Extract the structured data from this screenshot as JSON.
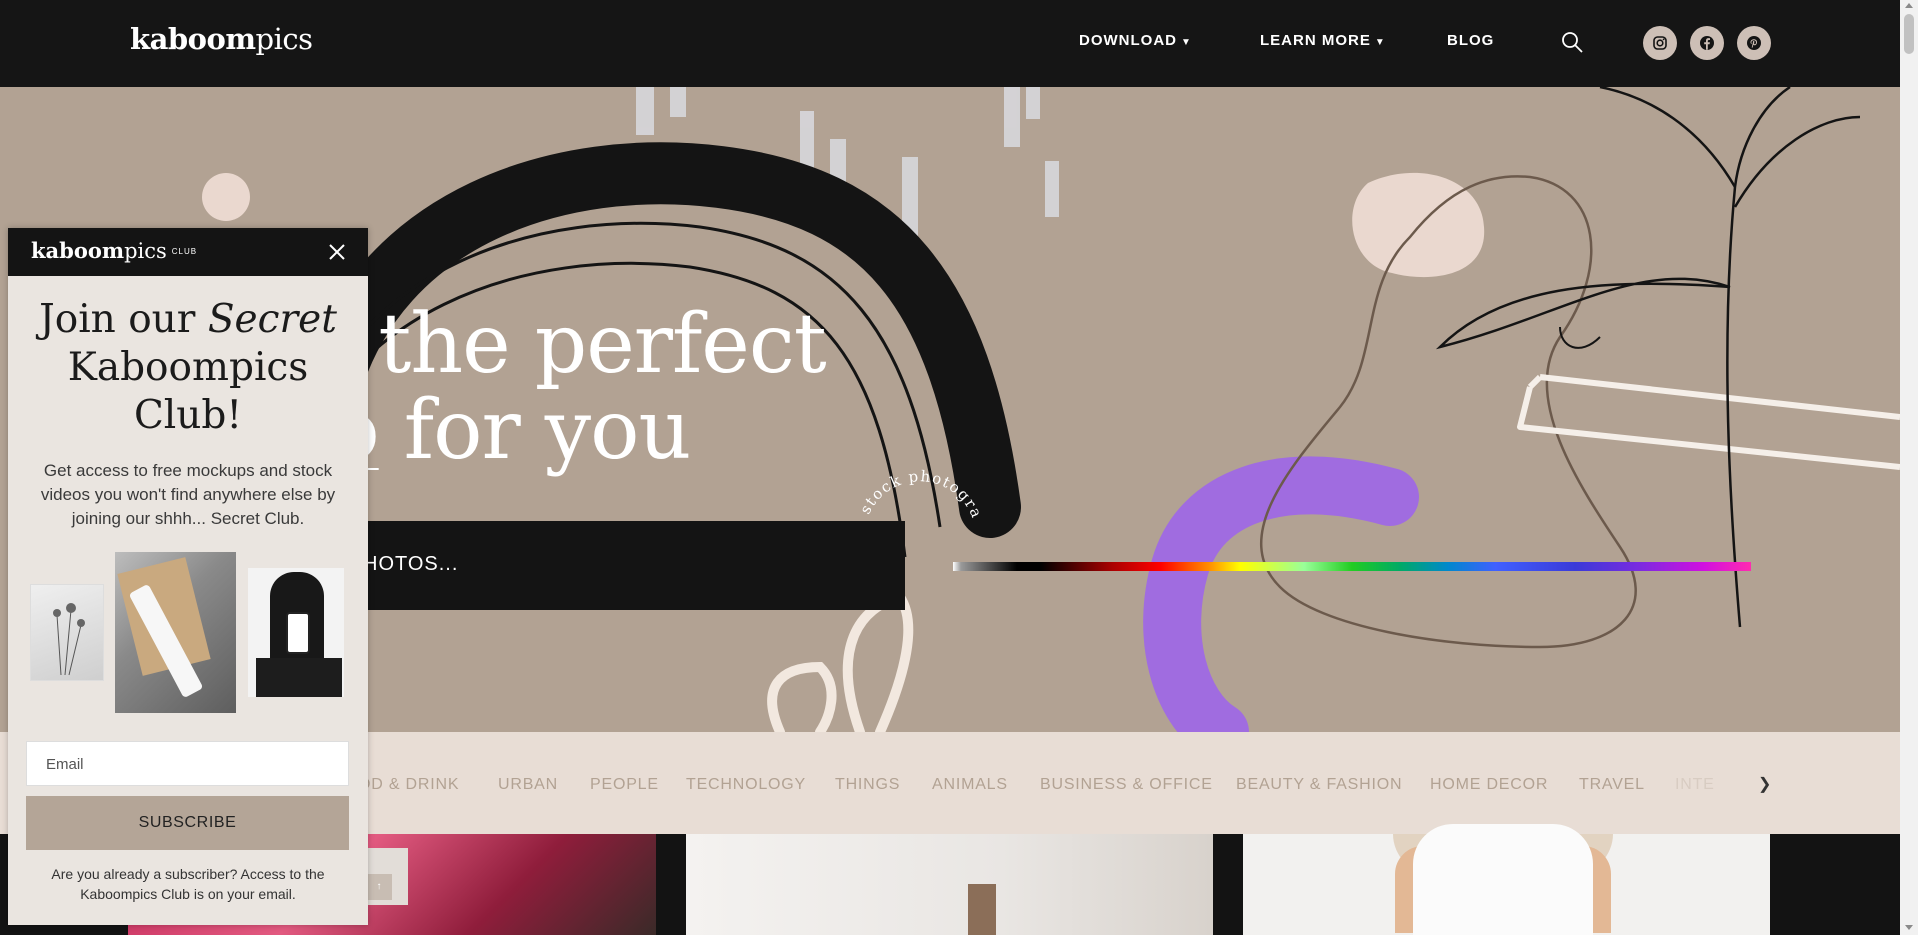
{
  "header": {
    "logo_bold": "kaboom",
    "logo_thin": "pics",
    "nav": [
      {
        "label": "DOWNLOAD",
        "has_dropdown": true
      },
      {
        "label": "LEARN MORE",
        "has_dropdown": true
      },
      {
        "label": "BLOG",
        "has_dropdown": false
      }
    ],
    "search_icon": "search-icon",
    "social": [
      "instagram-icon",
      "facebook-icon",
      "pinterest-icon"
    ]
  },
  "hero": {
    "title_line1": "nd the perfect",
    "title_line2_underlined": "oto",
    "title_line2_rest": " for you",
    "search_placeholder": "HOTOS...",
    "circle_text": "free stock photography"
  },
  "categories": {
    "items": [
      "OD & DRINK",
      "URBAN",
      "PEOPLE",
      "TECHNOLOGY",
      "THINGS",
      "ANIMALS",
      "BUSINESS & OFFICE",
      "BEAUTY & FASHION",
      "HOME DECOR",
      "TRAVEL",
      "INTE"
    ],
    "next_icon": "chevron-right-icon"
  },
  "popup": {
    "logo_bold": "kaboom",
    "logo_thin": "pics",
    "logo_badge": "CLUB",
    "title_part1": "Join our ",
    "title_italic": "Secret",
    "title_part2": "Kaboompics",
    "title_part3": "Club!",
    "description": "Get access to free mockups and stock videos you won't find anywhere else by joining our shhh... Secret Club.",
    "email_placeholder": "Email",
    "subscribe_label": "SUBSCRIBE",
    "note": "Are you already a subscriber? Access to the Kaboompics Club is on your email."
  },
  "colors": {
    "header_bg": "#151515",
    "hero_bg": "#b2a293",
    "category_bg": "#e8ddd5",
    "category_text": "#b2a293",
    "popup_bg": "#eae5e0",
    "subscribe_bg": "#b4a597"
  }
}
